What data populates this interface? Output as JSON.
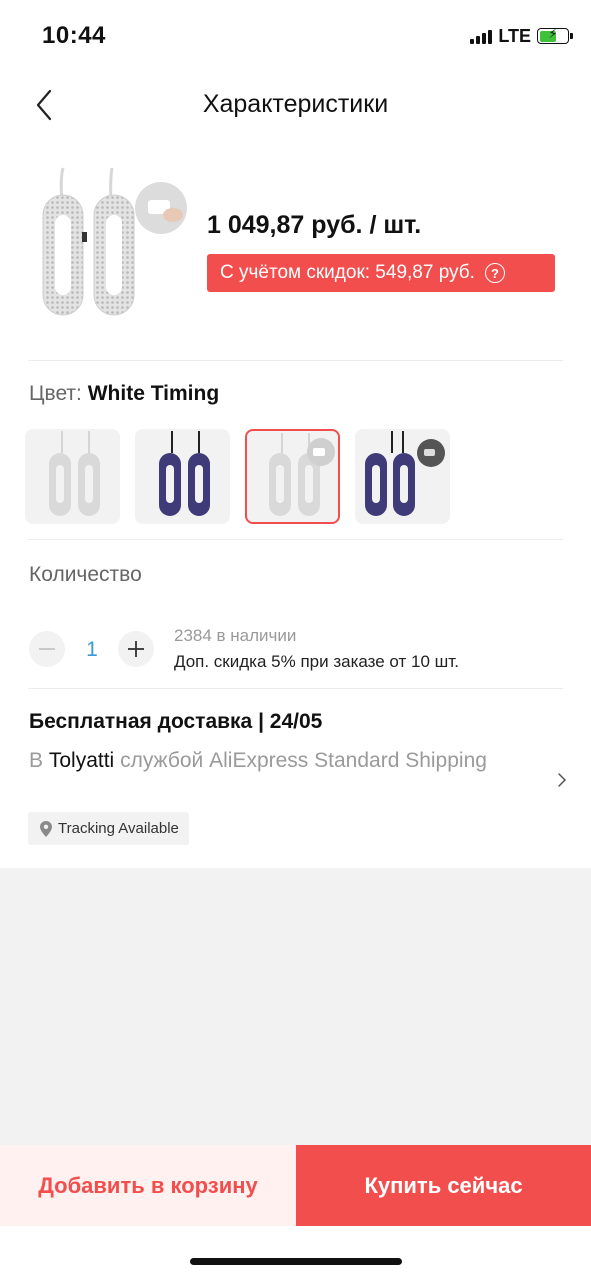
{
  "status_bar": {
    "time": "10:44",
    "network": "LTE"
  },
  "nav": {
    "title": "Характеристики",
    "back_icon": "chevron-left-icon"
  },
  "product": {
    "price": "1 049,87 руб. / шт.",
    "discount_text": "С учётом скидок: 549,87 руб.",
    "discount_help": "?",
    "accent_color": "#f24e4e"
  },
  "color": {
    "label": "Цвет:",
    "value": "White Timing",
    "selected_index": 2
  },
  "quantity": {
    "title": "Количество",
    "value": "1",
    "stock": "2384 в наличии",
    "bulk_discount": "Доп. скидка 5% при заказе от 10 шт."
  },
  "shipping": {
    "title": "Бесплатная доставка | 24/05",
    "prefix": "В",
    "city": "Tolyatti",
    "service": "службой AliExpress Standard Shipping",
    "tracking": "Tracking Available"
  },
  "actions": {
    "add_to_cart": "Добавить в корзину",
    "buy_now": "Купить сейчас"
  }
}
